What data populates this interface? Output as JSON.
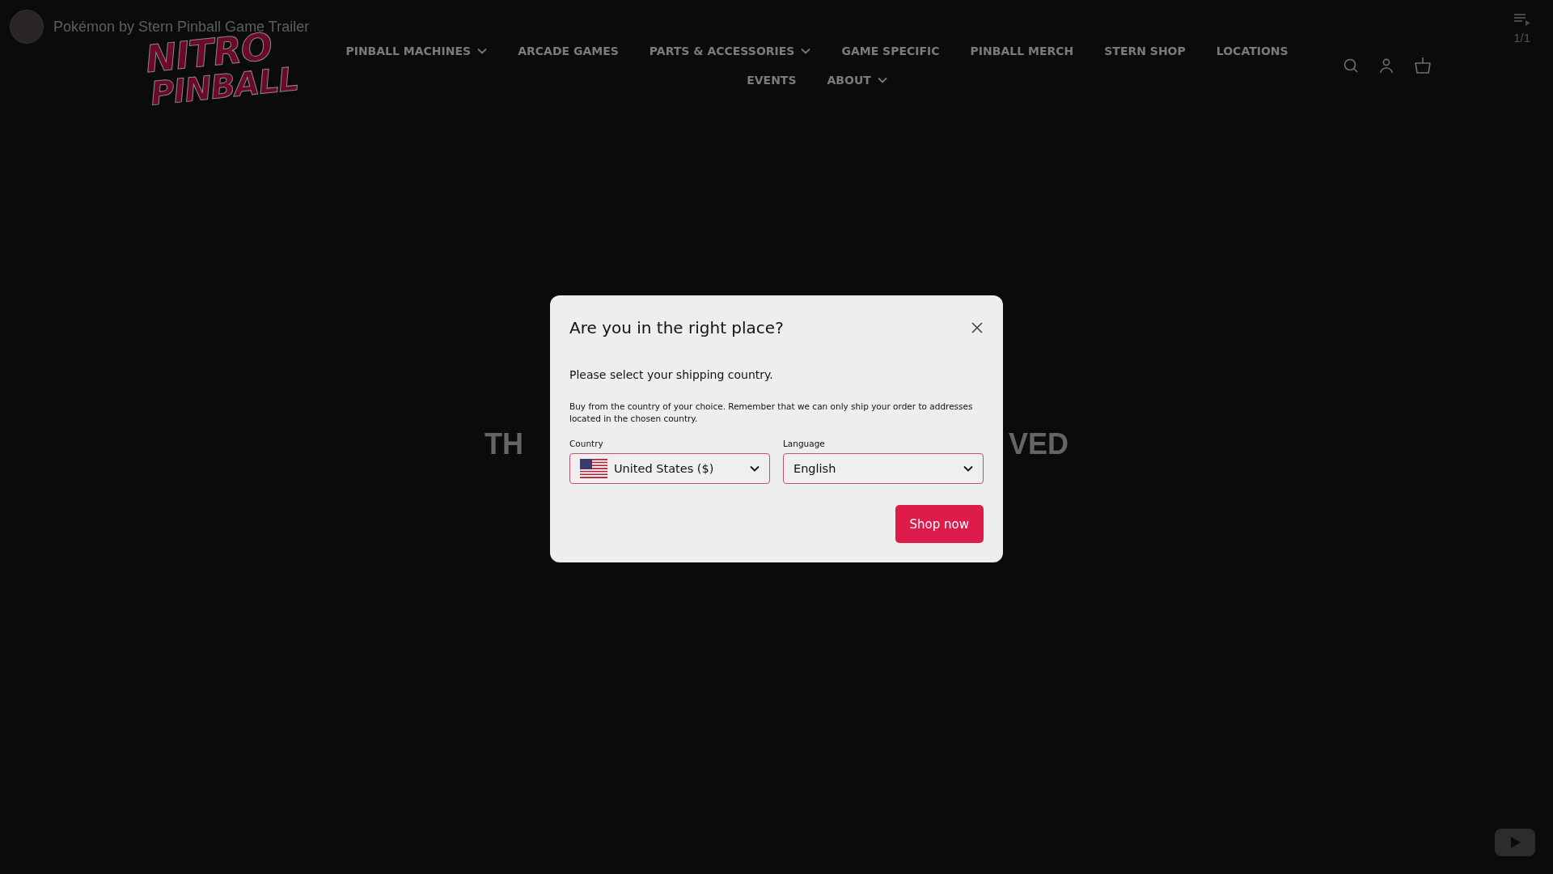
{
  "video_overlay": {
    "title": "Pokémon by Stern Pinball Game Trailer",
    "playlist_count": "1/1"
  },
  "logo": {
    "line_1": "NITRO",
    "line_2": "PINBALL"
  },
  "nav": [
    {
      "label": "PINBALL MACHINES",
      "has_dropdown": true
    },
    {
      "label": "ARCADE GAMES",
      "has_dropdown": false
    },
    {
      "label": "PARTS & ACCESSORIES",
      "has_dropdown": true
    },
    {
      "label": "GAME SPECIFIC",
      "has_dropdown": false
    },
    {
      "label": "PINBALL MERCH",
      "has_dropdown": false
    },
    {
      "label": "STERN SHOP",
      "has_dropdown": false
    },
    {
      "label": "LOCATIONS",
      "has_dropdown": false
    },
    {
      "label": "EVENTS",
      "has_dropdown": false
    },
    {
      "label": "ABOUT",
      "has_dropdown": true
    }
  ],
  "background_heading": {
    "left_part": "TH",
    "right_part": "VED"
  },
  "modal": {
    "title": "Are you in the right place?",
    "subtitle": "Please select your shipping country.",
    "description": "Buy from the country of your choice. Remember that we can only ship your order to addresses located in the chosen country.",
    "fields": [
      {
        "label": "Country",
        "value": "United States ($)",
        "kind": "flag"
      },
      {
        "label": "Language",
        "value": "English",
        "kind": "plain"
      }
    ],
    "button": "Shop now"
  }
}
